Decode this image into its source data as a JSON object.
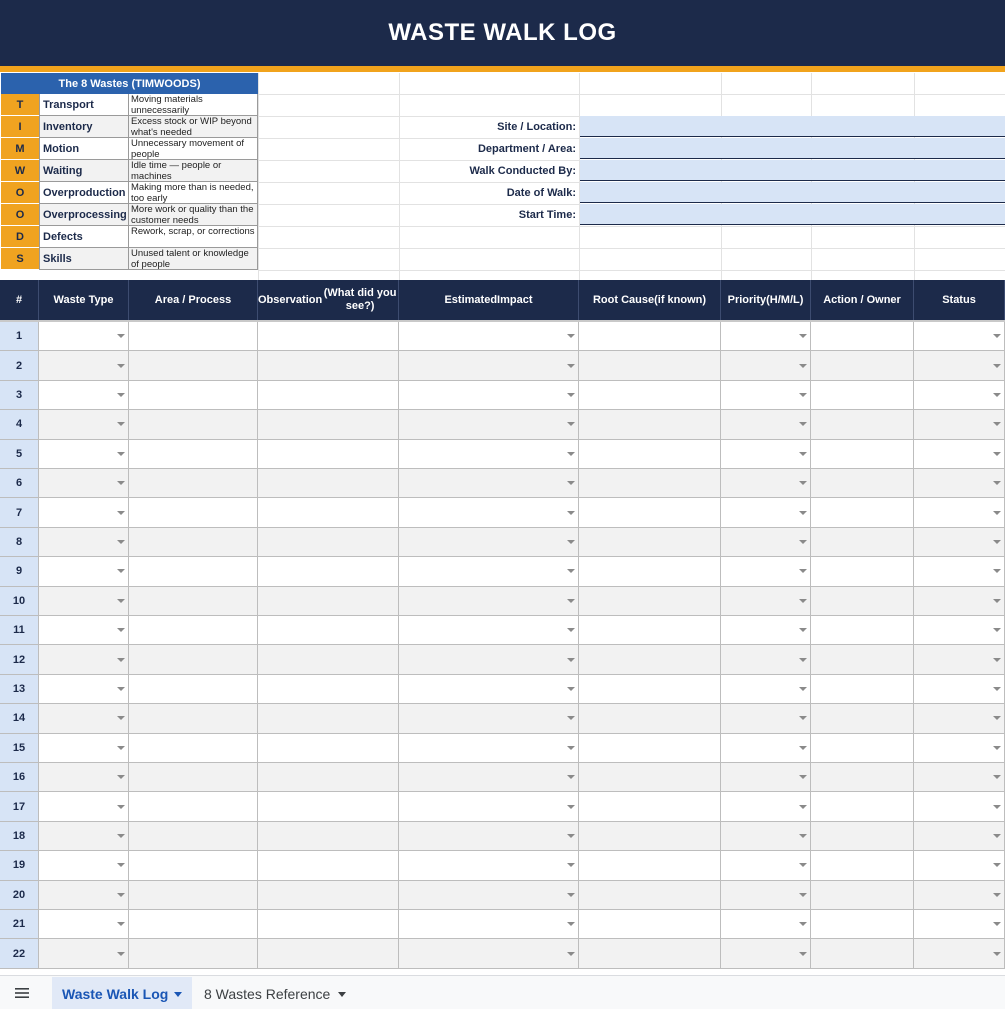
{
  "title": "WASTE WALK LOG",
  "colors": {
    "navy": "#1c2a4a",
    "gold": "#f1a31c",
    "blue_header": "#2b62ad",
    "input_fill": "#d7e4f6"
  },
  "timwoods": {
    "header": "The 8 Wastes (TIMWOODS)",
    "items": [
      {
        "letter": "T",
        "name": "Transport",
        "desc": "Moving materials unnecessarily"
      },
      {
        "letter": "I",
        "name": "Inventory",
        "desc": "Excess stock or WIP beyond what's needed"
      },
      {
        "letter": "M",
        "name": "Motion",
        "desc": "Unnecessary movement of people"
      },
      {
        "letter": "W",
        "name": "Waiting",
        "desc": "Idle time — people or machines"
      },
      {
        "letter": "O",
        "name": "Overproduction",
        "desc": "Making more than is needed, too early"
      },
      {
        "letter": "O",
        "name": "Overprocessing",
        "desc": "More work or quality than the customer needs"
      },
      {
        "letter": "D",
        "name": "Defects",
        "desc": "Rework, scrap, or corrections"
      },
      {
        "letter": "S",
        "name": "Skills",
        "desc": "Unused talent or knowledge of people"
      }
    ]
  },
  "meta_fields": [
    {
      "label": "Site / Location:",
      "value": ""
    },
    {
      "label": "Department / Area:",
      "value": ""
    },
    {
      "label": "Walk Conducted By:",
      "value": ""
    },
    {
      "label": "Date of Walk:",
      "value": ""
    },
    {
      "label": "Start Time:",
      "value": ""
    }
  ],
  "log_columns": [
    {
      "label": "#",
      "dropdown": false
    },
    {
      "label": "Waste Type",
      "dropdown": true
    },
    {
      "label": "Area / Process",
      "dropdown": false
    },
    {
      "label": "Observation\n(What did you see?)",
      "dropdown": false
    },
    {
      "label": "Estimated\nImpact",
      "dropdown": true
    },
    {
      "label": "Root Cause\n(if known)",
      "dropdown": false
    },
    {
      "label": "Priority\n(H/M/L)",
      "dropdown": true
    },
    {
      "label": "Action / Owner",
      "dropdown": false
    },
    {
      "label": "Status",
      "dropdown": true
    }
  ],
  "row_numbers": [
    "1",
    "2",
    "3",
    "4",
    "5",
    "6",
    "7",
    "8",
    "9",
    "10",
    "11",
    "12",
    "13",
    "14",
    "15",
    "16",
    "17",
    "18",
    "19",
    "20",
    "21",
    "22"
  ],
  "tabs": [
    {
      "label": "Waste Walk Log",
      "active": true
    },
    {
      "label": "8 Wastes Reference",
      "active": false
    }
  ],
  "icons": {
    "menu": "hamburger-menu-icon",
    "dropdown": "chevron-down-icon"
  }
}
